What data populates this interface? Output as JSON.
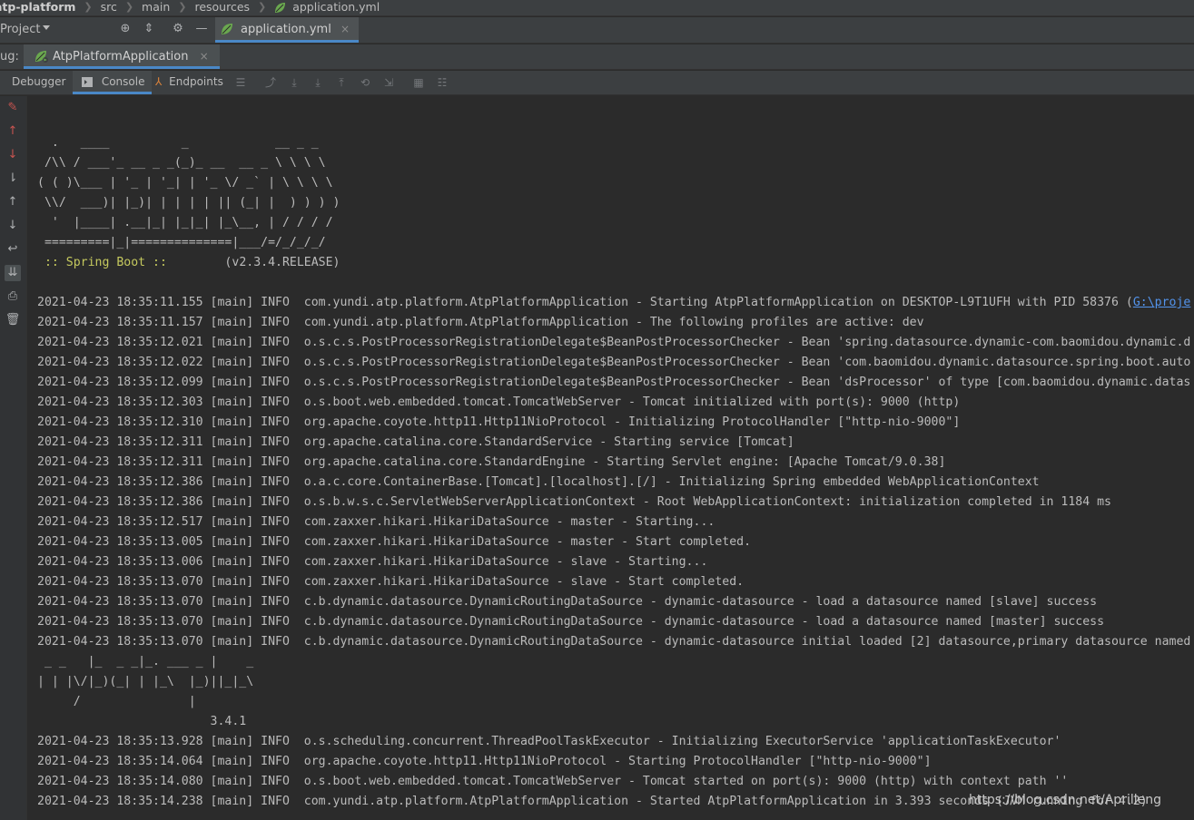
{
  "breadcrumb": {
    "items": [
      "atp-platform",
      "src",
      "main",
      "resources",
      "application.yml"
    ]
  },
  "toolbar": {
    "project_label": "Project",
    "editor_tab": "application.yml",
    "close_symbol": "×"
  },
  "debug": {
    "label": "ug:",
    "run_tab": "AtpPlatformApplication",
    "close_symbol": "×"
  },
  "subtabs": {
    "debugger": "Debugger",
    "console": "Console",
    "endpoints": "Endpoints"
  },
  "icons": {
    "leaf_color": "#6aa84f",
    "accent": "#4a88c7",
    "stop_red": "#c75450"
  },
  "console": {
    "banner": [
      "  .   ____          _            __ _ _",
      " /\\\\ / ___'_ __ _ _(_)_ __  __ _ \\ \\ \\ \\",
      "( ( )\\___ | '_ | '_| | '_ \\/ _` | \\ \\ \\ \\",
      " \\\\/  ___)| |_)| | | | | || (_| |  ) ) ) )",
      "  '  |____| .__|_| |_|_| |_\\__, | / / / /",
      " =========|_|==============|___/=/_/_/_/"
    ],
    "spring_label": " :: Spring Boot :: ",
    "spring_version": "       (v2.3.4.RELEASE)",
    "lines_a": [
      "2021-04-23 18:35:11.155 [main] INFO  com.yundi.atp.platform.AtpPlatformApplication - Starting AtpPlatformApplication on DESKTOP-L9T1UFH with PID 58376 (",
      "2021-04-23 18:35:11.157 [main] INFO  com.yundi.atp.platform.AtpPlatformApplication - The following profiles are active: dev",
      "2021-04-23 18:35:12.021 [main] INFO  o.s.c.s.PostProcessorRegistrationDelegate$BeanPostProcessorChecker - Bean 'spring.datasource.dynamic-com.baomidou.dynamic.d",
      "2021-04-23 18:35:12.022 [main] INFO  o.s.c.s.PostProcessorRegistrationDelegate$BeanPostProcessorChecker - Bean 'com.baomidou.dynamic.datasource.spring.boot.auto",
      "2021-04-23 18:35:12.099 [main] INFO  o.s.c.s.PostProcessorRegistrationDelegate$BeanPostProcessorChecker - Bean 'dsProcessor' of type [com.baomidou.dynamic.datas",
      "2021-04-23 18:35:12.303 [main] INFO  o.s.boot.web.embedded.tomcat.TomcatWebServer - Tomcat initialized with port(s): 9000 (http)",
      "2021-04-23 18:35:12.310 [main] INFO  org.apache.coyote.http11.Http11NioProtocol - Initializing ProtocolHandler [\"http-nio-9000\"]",
      "2021-04-23 18:35:12.311 [main] INFO  org.apache.catalina.core.StandardService - Starting service [Tomcat]",
      "2021-04-23 18:35:12.311 [main] INFO  org.apache.catalina.core.StandardEngine - Starting Servlet engine: [Apache Tomcat/9.0.38]",
      "2021-04-23 18:35:12.386 [main] INFO  o.a.c.core.ContainerBase.[Tomcat].[localhost].[/] - Initializing Spring embedded WebApplicationContext",
      "2021-04-23 18:35:12.386 [main] INFO  o.s.b.w.s.c.ServletWebServerApplicationContext - Root WebApplicationContext: initialization completed in 1184 ms",
      "2021-04-23 18:35:12.517 [main] INFO  com.zaxxer.hikari.HikariDataSource - master - Starting...",
      "2021-04-23 18:35:13.005 [main] INFO  com.zaxxer.hikari.HikariDataSource - master - Start completed.",
      "2021-04-23 18:35:13.006 [main] INFO  com.zaxxer.hikari.HikariDataSource - slave - Starting...",
      "2021-04-23 18:35:13.070 [main] INFO  com.zaxxer.hikari.HikariDataSource - slave - Start completed.",
      "2021-04-23 18:35:13.070 [main] INFO  c.b.dynamic.datasource.DynamicRoutingDataSource - dynamic-datasource - load a datasource named [slave] success",
      "2021-04-23 18:35:13.070 [main] INFO  c.b.dynamic.datasource.DynamicRoutingDataSource - dynamic-datasource - load a datasource named [master] success",
      "2021-04-23 18:35:13.070 [main] INFO  c.b.dynamic.datasource.DynamicRoutingDataSource - dynamic-datasource initial loaded [2] datasource,primary datasource named"
    ],
    "first_line_link": "G:\\proje",
    "mp_banner": [
      " _ _   |_  _ _|_. ___ _ |    _",
      "| | |\\/|_)(_| | |_\\  |_)||_|_\\",
      "     /               |",
      "                        3.4.1"
    ],
    "lines_b": [
      "2021-04-23 18:35:13.928 [main] INFO  o.s.scheduling.concurrent.ThreadPoolTaskExecutor - Initializing ExecutorService 'applicationTaskExecutor'",
      "2021-04-23 18:35:14.064 [main] INFO  org.apache.coyote.http11.Http11NioProtocol - Starting ProtocolHandler [\"http-nio-9000\"]",
      "2021-04-23 18:35:14.080 [main] INFO  o.s.boot.web.embedded.tomcat.TomcatWebServer - Tomcat started on port(s): 9000 (http) with context path ''",
      "2021-04-23 18:35:14.238 [main] INFO  com.yundi.atp.platform.AtpPlatformApplication - Started AtpPlatformApplication in 3.393 seconds (JVM running for 4.2)"
    ]
  },
  "watermark": "https://blog.csdn.net/Aprilleng"
}
